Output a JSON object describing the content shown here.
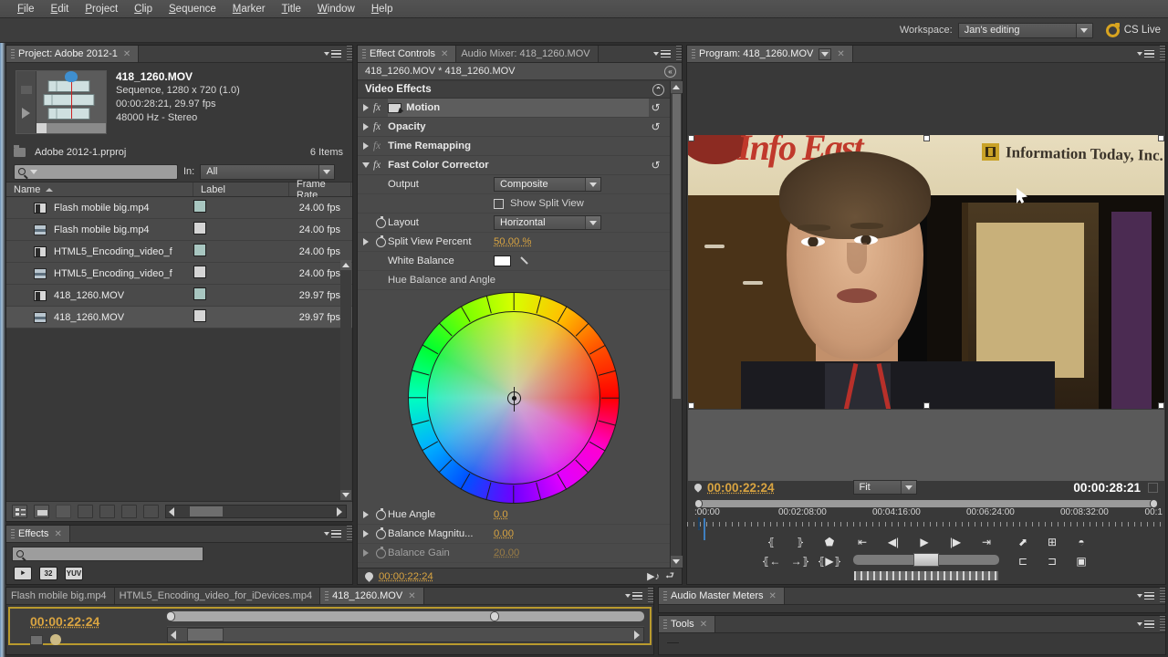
{
  "menu": {
    "items": [
      "File",
      "Edit",
      "Project",
      "Clip",
      "Sequence",
      "Marker",
      "Title",
      "Window",
      "Help"
    ]
  },
  "workspace": {
    "label": "Workspace:",
    "value": "Jan's editing",
    "cslive": "CS Live"
  },
  "project_panel": {
    "tab": "Project: Adobe 2012-1",
    "clip": {
      "title": "418_1260.MOV",
      "line1": "Sequence, 1280 x 720 (1.0)",
      "line2": "00:00:28:21, 29.97 fps",
      "line3": "48000 Hz - Stereo"
    },
    "file_name": "Adobe 2012-1.prproj",
    "item_count": "6 Items",
    "search_placeholder": "",
    "in_label": "In:",
    "in_value": "All",
    "columns": [
      "Name",
      "Label",
      "Frame Rate"
    ],
    "rows": [
      {
        "name": "Flash mobile big.mp4",
        "icon": "audio-video-icon",
        "label_color": "#a8c6c0",
        "frame_rate": "24.00 fps"
      },
      {
        "name": "Flash mobile big.mp4",
        "icon": "video-icon",
        "label_color": "#d5d5d5",
        "frame_rate": "24.00 fps"
      },
      {
        "name": "HTML5_Encoding_video_f",
        "icon": "audio-video-icon",
        "label_color": "#a8c6c0",
        "frame_rate": "24.00 fps"
      },
      {
        "name": "HTML5_Encoding_video_f",
        "icon": "video-icon",
        "label_color": "#d5d5d5",
        "frame_rate": "24.00 fps"
      },
      {
        "name": "418_1260.MOV",
        "icon": "audio-video-icon",
        "label_color": "#a8c6c0",
        "frame_rate": "29.97 fps"
      },
      {
        "name": "418_1260.MOV",
        "icon": "video-icon",
        "label_color": "#d5d5d5",
        "frame_rate": "29.97 fps"
      }
    ]
  },
  "effects_panel": {
    "tab": "Effects",
    "search_placeholder": "",
    "badges": [
      "accel",
      "32",
      "YUV"
    ]
  },
  "effect_controls": {
    "tabs": [
      {
        "label": "Effect Controls",
        "active": true
      },
      {
        "label": "Audio Mixer: 418_1260.MOV",
        "active": false
      }
    ],
    "clip_header": "418_1260.MOV * 418_1260.MOV",
    "section_title": "Video Effects",
    "effects": [
      {
        "name": "Motion",
        "enabled": true,
        "expanded": false,
        "has_reset": true
      },
      {
        "name": "Opacity",
        "enabled": true,
        "expanded": false,
        "has_reset": true
      },
      {
        "name": "Time Remapping",
        "enabled": false,
        "expanded": false,
        "has_reset": false
      },
      {
        "name": "Fast Color Corrector",
        "enabled": true,
        "expanded": true,
        "has_reset": true
      }
    ],
    "params": {
      "output_label": "Output",
      "output_value": "Composite",
      "split_view_label": "Show Split View",
      "split_view_checked": false,
      "layout_label": "Layout",
      "layout_value": "Horizontal",
      "split_percent_label": "Split View Percent",
      "split_percent_value": "50.00 %",
      "white_balance_label": "White Balance",
      "white_balance_color": "#ffffff",
      "hue_section_label": "Hue Balance and Angle",
      "hue_angle_label": "Hue Angle",
      "hue_angle_value": "0.0",
      "balance_magnitude_label": "Balance Magnitu...",
      "balance_magnitude_value": "0.00",
      "balance_gain_label": "Balance Gain",
      "balance_gain_value": "20.00"
    },
    "footer_timecode": "00:00:22:24"
  },
  "program_monitor": {
    "tab": "Program: 418_1260.MOV",
    "current_timecode": "00:00:22:24",
    "zoom_level": "Fit",
    "duration_timecode": "00:00:28:21",
    "ruler_ticks": [
      ":00:00",
      "00:02:08:00",
      "00:04:16:00",
      "00:06:24:00",
      "00:08:32:00",
      "00:1"
    ],
    "video": {
      "banner_text": "Info East",
      "company_text": "Information Today, Inc."
    },
    "transport": {
      "in_point": "set-in-point-icon",
      "out_point": "set-out-point-icon",
      "marker": "add-marker-icon",
      "goto_in": "go-to-in-icon",
      "goto_out": "go-to-out-icon",
      "play_in_out": "play-in-to-out-icon",
      "step_back": "step-back-icon",
      "play": "play-icon",
      "step_fwd": "step-forward-icon",
      "goto_prev": "go-to-previous-edit-icon",
      "goto_next": "go-to-next-edit-icon",
      "export": "export-frame-icon",
      "safe": "safe-margins-icon",
      "output": "output-icon",
      "lift": "lift-icon",
      "extract": "extract-icon",
      "snapshot": "snapshot-icon"
    }
  },
  "timeline": {
    "tabs": [
      {
        "label": "Flash mobile big.mp4",
        "active": false
      },
      {
        "label": "HTML5_Encoding_video_for_iDevices.mp4",
        "active": false
      },
      {
        "label": "418_1260.MOV",
        "active": true
      }
    ],
    "timecode": "00:00:22:24"
  },
  "audio_meters": {
    "tab": "Audio Master Meters"
  },
  "tools_panel": {
    "tab": "Tools"
  }
}
